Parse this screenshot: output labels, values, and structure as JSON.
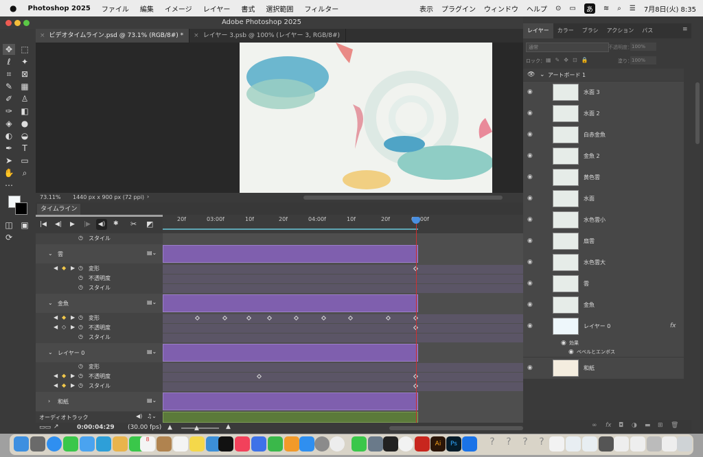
{
  "menubar": {
    "app": "Photoshop 2025",
    "items": [
      "ファイル",
      "編集",
      "イメージ",
      "レイヤー",
      "書式",
      "選択範囲",
      "フィルター",
      "表示",
      "プラグイン",
      "ウィンドウ",
      "ヘルプ"
    ],
    "ime": "あ",
    "datetime": "7月8日(火) 8:35"
  },
  "window": {
    "title": "Adobe Photoshop 2025"
  },
  "doc_tabs": [
    {
      "label": "ビデオタイムライン.psd @ 73.1% (RGB/8#) *"
    },
    {
      "label": "レイヤー 3.psb @ 100% (レイヤー 3, RGB/8#)"
    }
  ],
  "status": {
    "zoom": "73.11%",
    "info": "1440 px x 900 px (72 ppi)"
  },
  "timeline": {
    "tab": "タイムライン",
    "ruler_labels": [
      "20f",
      "03:00f",
      "10f",
      "20f",
      "04:00f",
      "10f",
      "20f",
      "05:00f"
    ],
    "rows": {
      "style_top": "スタイル",
      "group1": "雲",
      "g1_transform": "変形",
      "g1_opacity": "不透明度",
      "g1_style": "スタイル",
      "group2": "金魚",
      "g2_transform": "変形",
      "g2_opacity": "不透明度",
      "g2_style": "スタイル",
      "group3": "レイヤー 0",
      "g3_transform": "変形",
      "g3_opacity": "不透明度",
      "g3_style": "スタイル",
      "group4": "和紙",
      "audio": "オーディオトラック"
    },
    "timecode": "0:00:04:29",
    "fps": "(30.00 fps)"
  },
  "layers_panel": {
    "tabs": [
      "レイヤー",
      "カラー",
      "ブラシ",
      "アクション",
      "パス"
    ],
    "blend_mode": "通常",
    "opacity_label": "不透明度：",
    "opacity": "100%",
    "lock_label": "ロック：",
    "fill_label": "塗り：",
    "fill": "100%",
    "artboard": "アートボード 1",
    "layers": [
      "水面 3",
      "水面 2",
      "白赤金魚",
      "金魚 2",
      "黄色雲",
      "水面",
      "水色雲小",
      "扇雲",
      "水色雲大",
      "雲",
      "金魚",
      "レイヤー 0",
      "和紙"
    ],
    "effects_label": "効果",
    "bevel": "ベベルとエンボス",
    "fx": "fx"
  },
  "colors": {
    "clip": "#7f5fae",
    "audio_clip": "#5b7a3a",
    "playhead": "#d03030"
  }
}
